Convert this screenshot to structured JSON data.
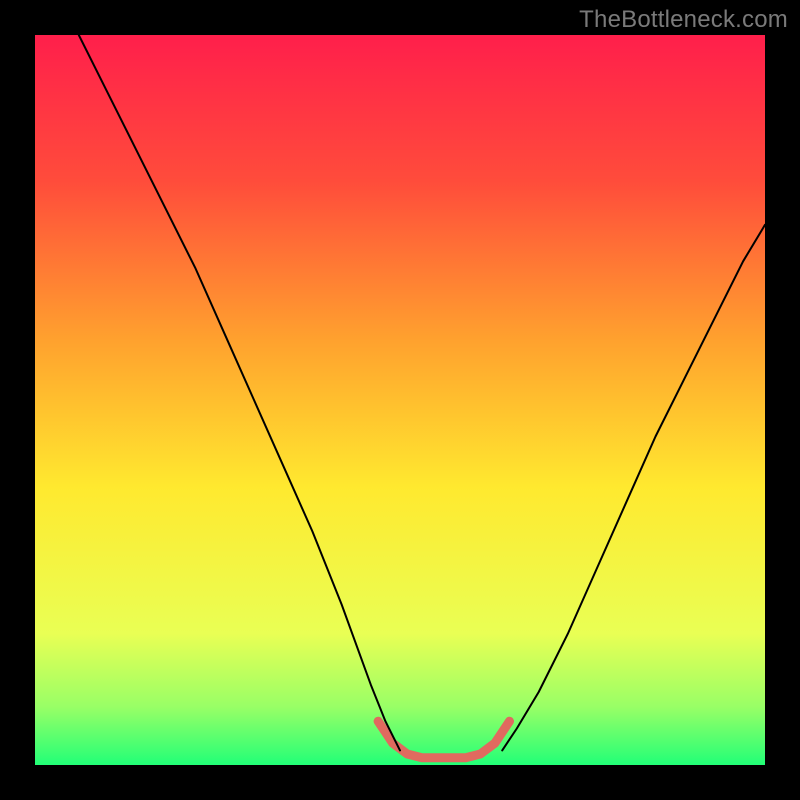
{
  "watermark": "TheBottleneck.com",
  "chart_data": {
    "type": "line",
    "title": "",
    "xlabel": "",
    "ylabel": "",
    "xlim": [
      0,
      100
    ],
    "ylim": [
      0,
      100
    ],
    "gradient_stops": [
      {
        "offset": 0,
        "color": "#ff1f4b"
      },
      {
        "offset": 20,
        "color": "#ff4c3b"
      },
      {
        "offset": 42,
        "color": "#ffa22e"
      },
      {
        "offset": 62,
        "color": "#ffe92f"
      },
      {
        "offset": 82,
        "color": "#e9ff54"
      },
      {
        "offset": 92,
        "color": "#99ff66"
      },
      {
        "offset": 100,
        "color": "#22ff77"
      }
    ],
    "series": [
      {
        "name": "curve-left",
        "x": [
          6,
          10,
          14,
          18,
          22,
          26,
          30,
          34,
          38,
          42,
          46,
          48,
          50
        ],
        "y": [
          100,
          92,
          84,
          76,
          68,
          59,
          50,
          41,
          32,
          22,
          11,
          6,
          2
        ],
        "stroke": "#000000",
        "width": 2
      },
      {
        "name": "curve-right",
        "x": [
          64,
          66,
          69,
          73,
          77,
          81,
          85,
          89,
          93,
          97,
          100
        ],
        "y": [
          2,
          5,
          10,
          18,
          27,
          36,
          45,
          53,
          61,
          69,
          74
        ],
        "stroke": "#000000",
        "width": 2
      },
      {
        "name": "valley-highlight",
        "x": [
          47,
          49,
          51,
          53,
          55,
          57,
          59,
          61,
          63,
          65
        ],
        "y": [
          6,
          3,
          1.5,
          1,
          1,
          1,
          1,
          1.5,
          3,
          6
        ],
        "stroke": "#e06a5f",
        "width": 9
      }
    ]
  }
}
